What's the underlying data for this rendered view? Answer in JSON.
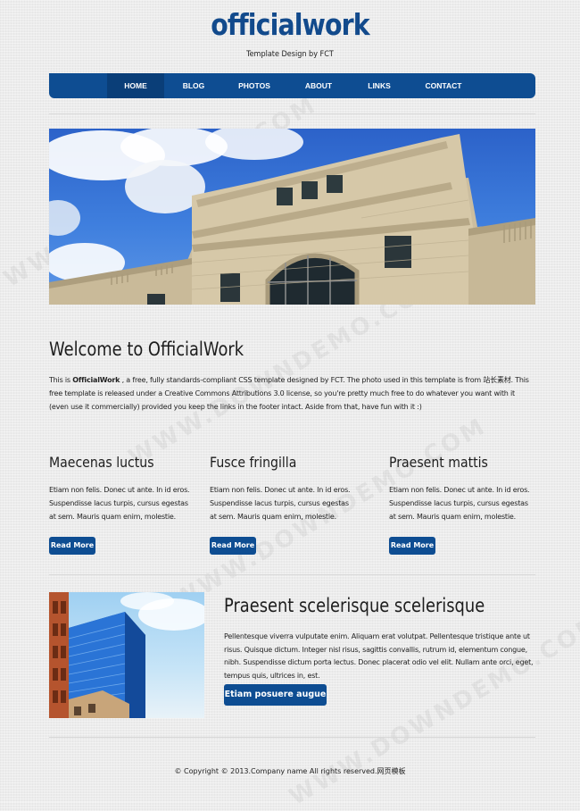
{
  "header": {
    "site_title": "officialwork",
    "tagline": "Template Design by FCT"
  },
  "nav": {
    "items": [
      "HOME",
      "BLOG",
      "PHOTOS",
      "ABOUT",
      "LINKS",
      "CONTACT"
    ],
    "active": "HOME"
  },
  "welcome": {
    "title": "Welcome to OfficialWork",
    "text_intro": "This is ",
    "text_bold": "OfficialWork",
    "text_rest": " , a free, fully standards-compliant CSS template designed by FCT. The photo used in this template is from 站长素材. This free template is released under a Creative Commons Attributions 3.0 license, so you're pretty much free to do whatever you want with it (even use it commercially) provided you keep the links in the footer intact. Aside from that, have fun with it :)"
  },
  "columns": [
    {
      "title": "Maecenas luctus",
      "text": "Etiam non felis. Donec ut ante. In id eros. Suspendisse lacus turpis, cursus egestas at sem. Mauris quam enim, molestie.",
      "button": "Read More"
    },
    {
      "title": "Fusce fringilla",
      "text": "Etiam non felis. Donec ut ante. In id eros. Suspendisse lacus turpis, cursus egestas at sem. Mauris quam enim, molestie.",
      "button": "Read More"
    },
    {
      "title": "Praesent mattis",
      "text": "Etiam non felis. Donec ut ante. In id eros. Suspendisse lacus turpis, cursus egestas at sem. Mauris quam enim, molestie.",
      "button": "Read More"
    }
  ],
  "feature": {
    "title": "Praesent scelerisque scelerisque",
    "text": "Pellentesque viverra vulputate enim. Aliquam erat volutpat. Pellentesque tristique ante ut risus. Quisque dictum. Integer nisl risus, sagittis convallis, rutrum id, elementum congue, nibh. Suspendisse dictum porta lectus. Donec placerat odio vel elit. Nullam ante orci, eget, tempus quis, ultrices in, est.",
    "button": "Etiam posuere augue"
  },
  "footer": {
    "text": "© Copyright © 2013.Company name All rights reserved.网页模板"
  },
  "watermark": "WWW.DOWNDEMO.COM",
  "colors": {
    "brand_blue": "#0e4d92",
    "nav_active": "#0a3e78",
    "title_blue": "#124a8c"
  }
}
